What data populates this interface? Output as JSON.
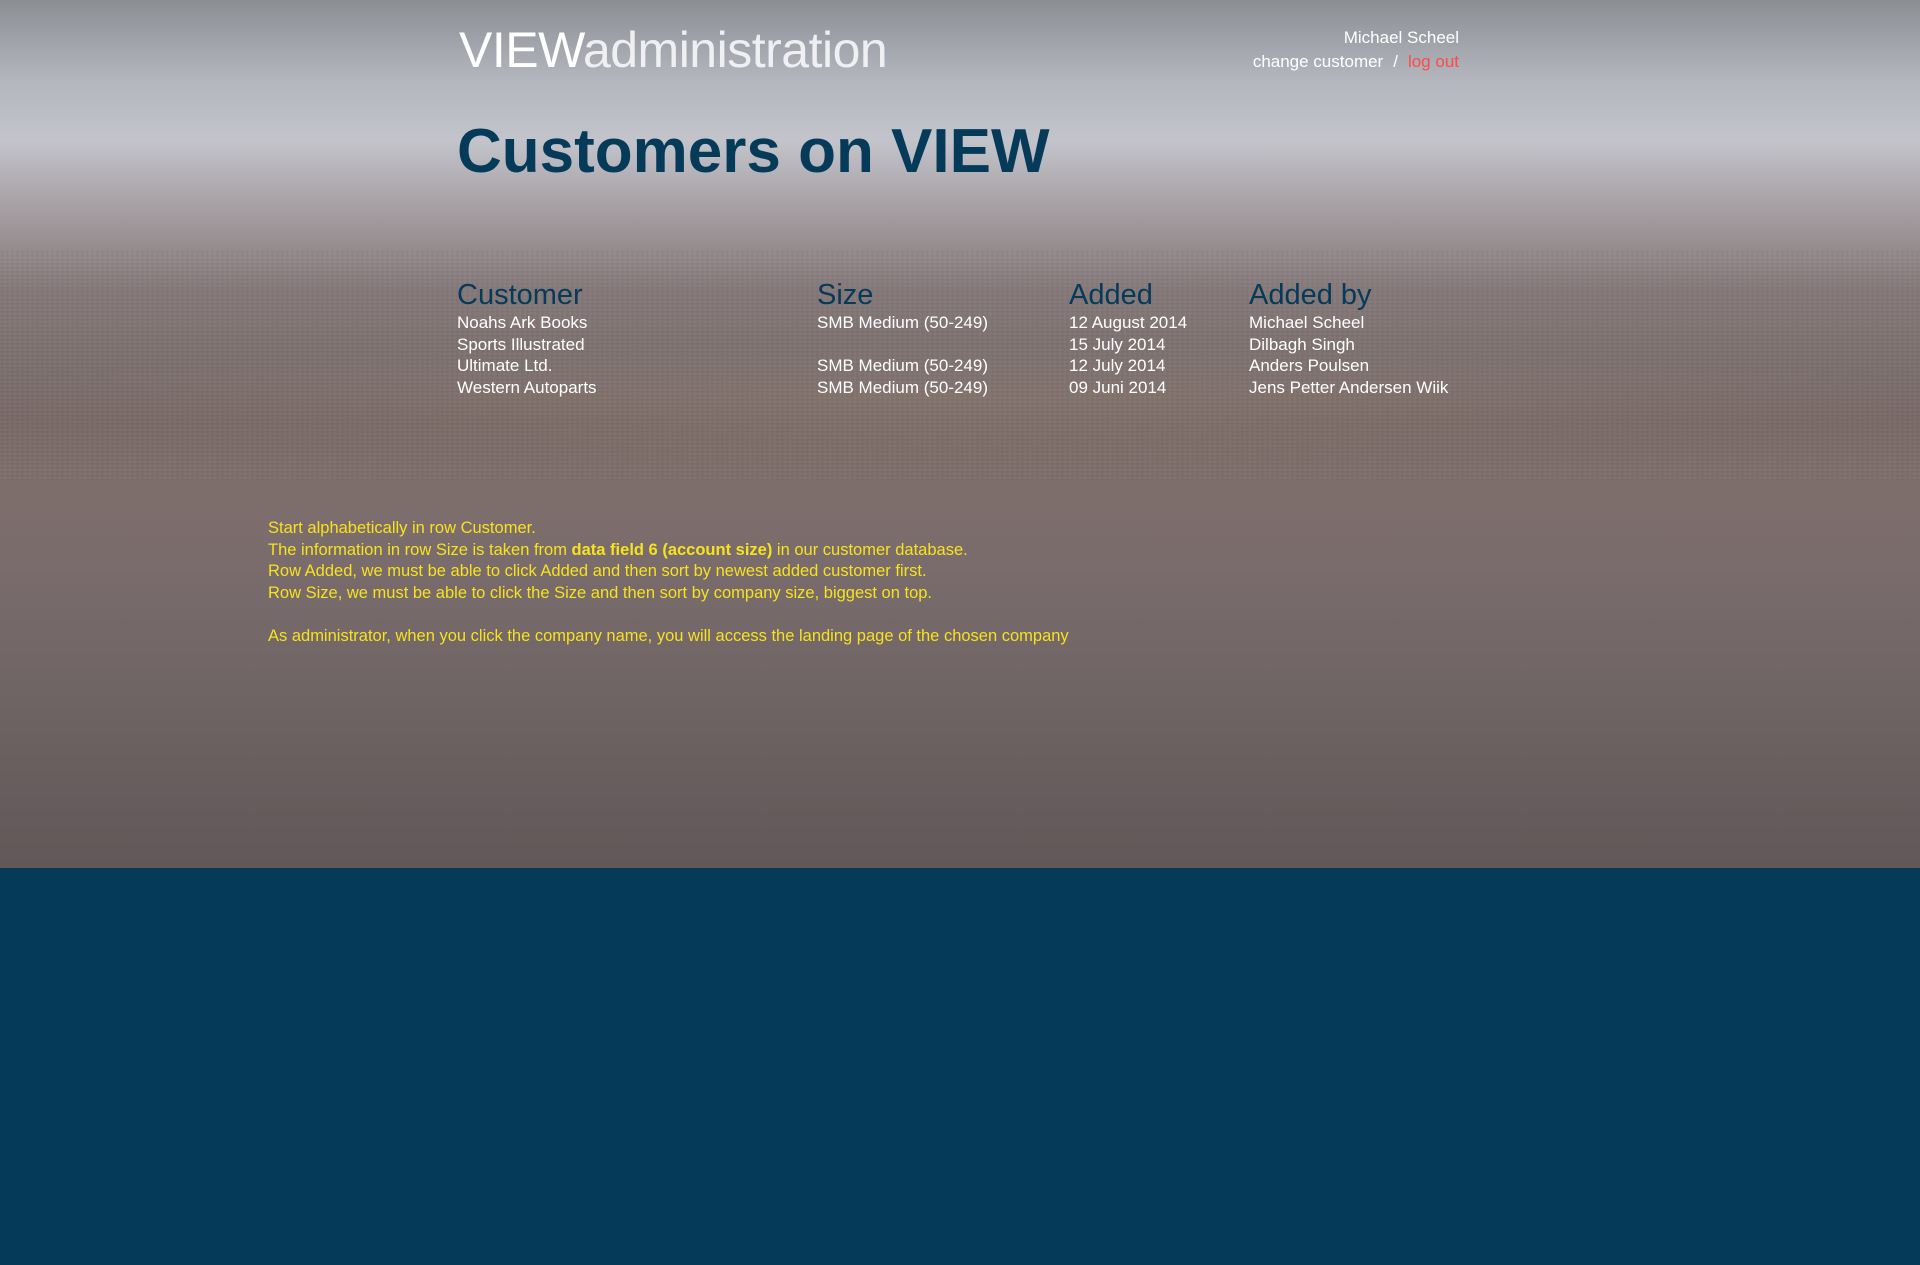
{
  "header": {
    "brand_strong": "VIEW",
    "brand_light": "administration",
    "user_name": "Michael Scheel",
    "change_customer": "change customer",
    "separator": "/",
    "log_out": "log out"
  },
  "page": {
    "title": "Customers on VIEW"
  },
  "table": {
    "columns": [
      "Customer",
      "Size",
      "Added",
      "Added by"
    ],
    "rows": [
      {
        "customer": "Noahs Ark Books",
        "size": "SMB Medium (50-249)",
        "added": "12 August 2014",
        "added_by": "Michael Scheel"
      },
      {
        "customer": "Sports Illustrated",
        "size": "",
        "added": "15 July 2014",
        "added_by": "Dilbagh Singh"
      },
      {
        "customer": "Ultimate Ltd.",
        "size": "SMB Medium (50-249)",
        "added": "12 July 2014",
        "added_by": "Anders Poulsen"
      },
      {
        "customer": "Western Autoparts",
        "size": "SMB Medium (50-249)",
        "added": "09 Juni 2014",
        "added_by": "Jens Petter Andersen Wiik"
      }
    ]
  },
  "notes": {
    "line1": "Start alphabetically in row Customer.",
    "line2_pre": "The information in row Size is taken from ",
    "line2_bold": "data field 6 (account size)",
    "line2_post": " in our customer database.",
    "line3": "Row Added, we must be able to click Added and then sort by newest added customer first.",
    "line4": "Row Size, we must be able to click the Size and then sort by company size, biggest on top.",
    "line5": "As administrator, when you click the company name, you will access the landing page of the chosen company"
  },
  "colors": {
    "navy": "#053a59",
    "note_yellow": "#f6e21e",
    "logout_red": "#ff4a4a"
  }
}
